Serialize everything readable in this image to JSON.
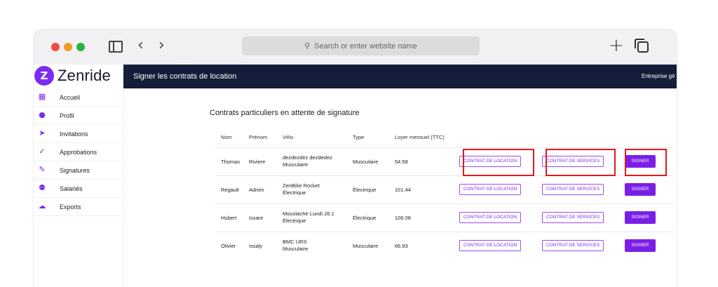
{
  "browser": {
    "url_placeholder": "Search or enter website name",
    "back_glyph": "‹",
    "forward_glyph": "›",
    "new_tab_glyph": "+",
    "search_glyph": "⚲"
  },
  "app": {
    "brand_name": "Zenride",
    "brand_glyph": "Z",
    "header_title": "Signer les contrats de location",
    "header_right": "Entreprise gé"
  },
  "sidebar": {
    "items": [
      {
        "label": "Accueil",
        "icon": "dashboard-icon",
        "glyph": "▦"
      },
      {
        "label": "Profil",
        "icon": "user-icon",
        "glyph": "●"
      },
      {
        "label": "Invitations",
        "icon": "send-icon",
        "glyph": "➤"
      },
      {
        "label": "Approbations",
        "icon": "check-icon",
        "glyph": "✓"
      },
      {
        "label": "Signatures",
        "icon": "pen-icon",
        "glyph": "✎"
      },
      {
        "label": "Salariés",
        "icon": "group-icon",
        "glyph": "⚉"
      },
      {
        "label": "Exports",
        "icon": "cloud-download-icon",
        "glyph": "☁"
      }
    ]
  },
  "main": {
    "section_title": "Contrats particuliers en attente de signature",
    "columns": [
      "Nom",
      "Prénom",
      "Vélo",
      "Type",
      "Loyer mensuel (TTC)"
    ],
    "rows": [
      {
        "nom": "Thomas",
        "prenom": "Riviere",
        "velo_model": "dezdezdez dezdedez",
        "velo_type": "Musculaire",
        "type": "Musculaire",
        "loyer": "54.58"
      },
      {
        "nom": "Regault",
        "prenom": "Adrien",
        "velo_model": "ZenBike Rocket",
        "velo_type": "Électrique",
        "type": "Électrique",
        "loyer": "101.44"
      },
      {
        "nom": "Hubert",
        "prenom": "Issare",
        "velo_model": "Moustache Lundi 26.1",
        "velo_type": "Électrique",
        "type": "Électrique",
        "loyer": "106.08"
      },
      {
        "nom": "Olivier",
        "prenom": "Issaly",
        "velo_model": "BMC URS",
        "velo_type": "Musculaire",
        "type": "Musculaire",
        "loyer": "66.93"
      }
    ],
    "btn_location": "CONTRAT DE LOCATION",
    "btn_services": "CONTRAT DE SERVICES",
    "btn_sign": "SIGNER"
  },
  "colors": {
    "accent": "#7b2cf0",
    "header_bg": "#141d3a",
    "highlight": "#e0191c"
  }
}
